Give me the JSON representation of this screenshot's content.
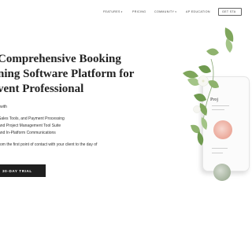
{
  "nav": {
    "items": [
      {
        "label": "FEATURES",
        "has_dropdown": true
      },
      {
        "label": "PRICING",
        "has_dropdown": false
      },
      {
        "label": "COMMUNITY",
        "has_dropdown": true
      },
      {
        "label": "AP EDUCATION",
        "has_dropdown": false
      }
    ],
    "cta_label": "GET STA"
  },
  "hero": {
    "headline_lines": [
      "Comprehensive Booking",
      "ning Software Platform for",
      "vent Professional"
    ],
    "lead": "with",
    "features": [
      "Sales Tools, and Payment Processing",
      "and Project Management Tool Suite",
      "and In-Platform Communications"
    ],
    "description": "om the first point of contact with your client to the day of",
    "trial_button": "30-DAY TRIAL"
  },
  "mockup": {
    "screen_title": "Proj"
  },
  "colors": {
    "button_bg": "#1f1f1f",
    "accent_peach": "#ecab9d",
    "leaf_green": "#7fa65c"
  },
  "icons": {
    "dropdown": "chevron-down-icon"
  }
}
